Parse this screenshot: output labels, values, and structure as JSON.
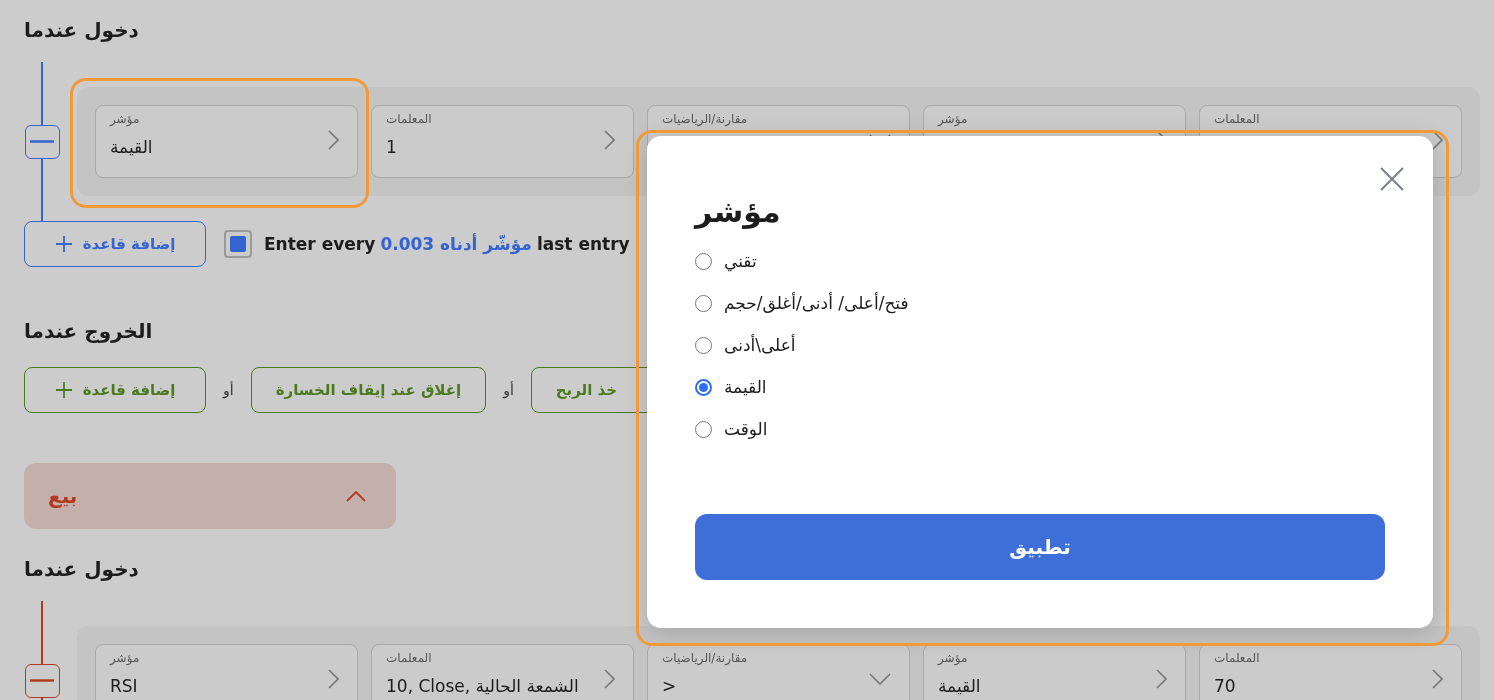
{
  "entry_section": {
    "title": "دخول عندما",
    "add_rule": "إضافة قاعدة",
    "conditions": [
      {
        "kind": "selector",
        "label": "المعلمات",
        "highlighted": false
      },
      {
        "kind": "selector",
        "label": "مؤشر",
        "highlighted": false
      },
      {
        "kind": "dropdown",
        "label": "مقارنة/الرياضيات",
        "highlighted": false
      },
      {
        "kind": "selector",
        "label": "المعلمات",
        "value": "1",
        "highlighted": false
      },
      {
        "kind": "selector",
        "label": "مؤشر",
        "value": "القيمة",
        "highlighted": true
      }
    ],
    "option": {
      "checked": true,
      "parts": [
        {
          "kind": "plain",
          "text": "last entry"
        },
        {
          "kind": "value",
          "text": "0.003 مؤشّر أدناه"
        },
        {
          "kind": "plain",
          "text": "Enter every"
        }
      ]
    }
  },
  "exit_section": {
    "title": "الخروج عندما",
    "items": [
      {
        "kind": "rule",
        "label": "خذ الربح"
      },
      {
        "kind": "or",
        "label": "أو"
      },
      {
        "kind": "rule",
        "label": "إغلاق عند إيقاف الخسارة"
      },
      {
        "kind": "or",
        "label": "أو"
      },
      {
        "kind": "add",
        "label": "إضافة قاعدة"
      }
    ]
  },
  "sell_section": {
    "title": "بيع",
    "expanded": true
  },
  "sell_entry": {
    "title": "دخول عندما",
    "conditions": [
      {
        "kind": "selector",
        "label": "المعلمات",
        "value": "70",
        "highlighted": false
      },
      {
        "kind": "selector",
        "label": "مؤشر",
        "value": "القيمة",
        "highlighted": false
      },
      {
        "kind": "dropdown",
        "label": "مقارنة/الرياضيات",
        "value": ">",
        "highlighted": false
      },
      {
        "kind": "selector",
        "label": "المعلمات",
        "value": "10, Close, الشمعة الحالية",
        "highlighted": false
      },
      {
        "kind": "selector",
        "label": "مؤشر",
        "value": "RSI",
        "highlighted": false
      }
    ]
  },
  "dialog": {
    "title": "مؤشر",
    "highlighted": true,
    "options": [
      {
        "label": "تقني",
        "selected": false
      },
      {
        "label": "فتح/أعلى/ أدنى/أغلق/حجم",
        "selected": false
      },
      {
        "label": "أعلى\\أدنى",
        "selected": false
      },
      {
        "label": "القيمة",
        "selected": true
      },
      {
        "label": "الوقت",
        "selected": false
      }
    ],
    "apply": "تطبيق"
  }
}
